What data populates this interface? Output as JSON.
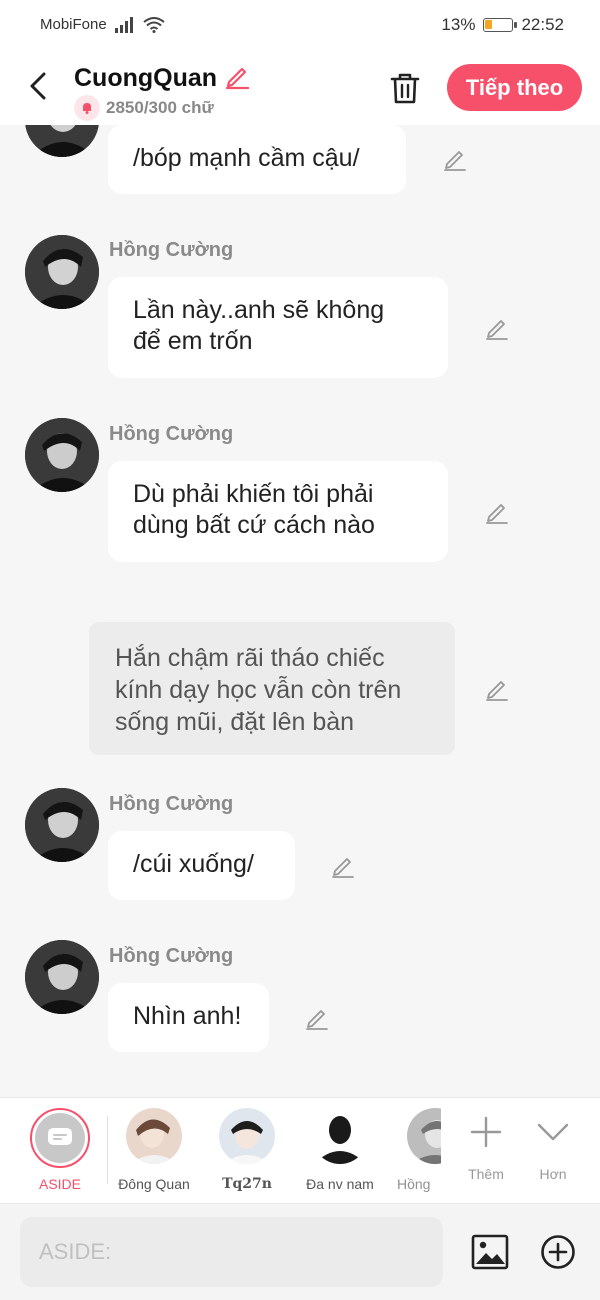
{
  "status_bar": {
    "carrier": "MobiFone",
    "battery_percent": "13%",
    "battery_level": 0.13,
    "time": "22:52"
  },
  "header": {
    "title": "CuongQuan",
    "word_count": "2850/300 chữ",
    "next_label": "Tiếp theo"
  },
  "messages": [
    {
      "type": "dialogue",
      "text": "/bóp mạnh cầm cậu/"
    },
    {
      "type": "dialogue",
      "sender": "Hồng Cường",
      "text": "Lần này..anh sẽ không\nđể em trốn"
    },
    {
      "type": "dialogue",
      "sender": "Hồng Cường",
      "text": "Dù phải khiến tôi phải\ndùng bất cứ cách nào"
    },
    {
      "type": "narration",
      "text": "Hắn chậm rãi tháo chiếc\nkính dạy học vẫn còn trên\nsống mũi, đặt lên bàn"
    },
    {
      "type": "dialogue",
      "sender": "Hồng Cường",
      "text": "/cúi xuống/"
    },
    {
      "type": "dialogue",
      "sender": "Hồng Cường",
      "text": "Nhìn anh!"
    }
  ],
  "characters": {
    "aside_label": "ASIDE",
    "items": [
      "Đông Quan",
      "Tq27n",
      "Đa nv nam",
      "Hồng"
    ],
    "add_label": "Thêm",
    "more_label": "Hơn"
  },
  "input": {
    "placeholder": "ASIDE:",
    "value": ""
  },
  "colors": {
    "accent": "#f7506b",
    "bubble": "#ffffff",
    "narration_bg": "#ececec",
    "background": "#f6f6f6"
  }
}
